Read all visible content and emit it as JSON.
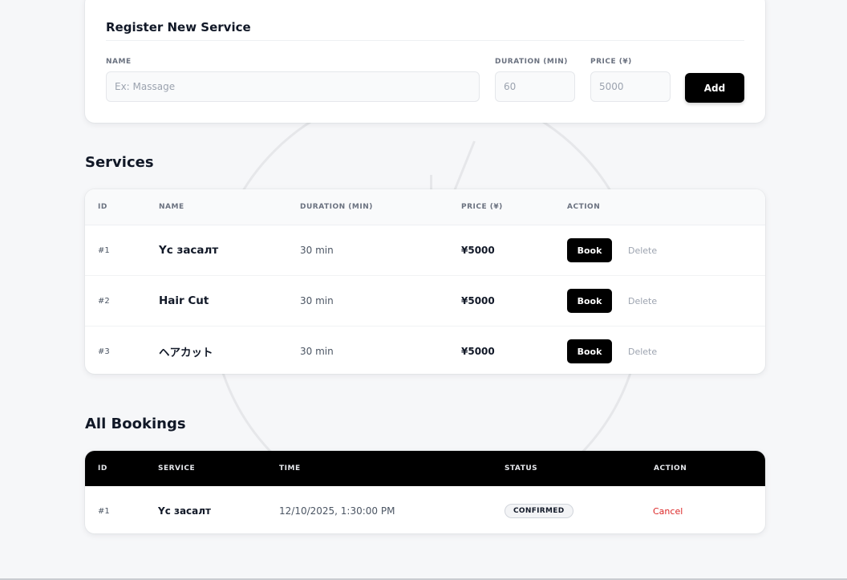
{
  "register": {
    "title": "Register New Service",
    "name_label": "NAME",
    "name_placeholder": "Ex: Massage",
    "duration_label": "DURATION (MIN)",
    "duration_placeholder": "60",
    "price_label": "PRICE (¥)",
    "price_placeholder": "5000",
    "add_label": "Add"
  },
  "services": {
    "title": "Services",
    "headers": {
      "id": "ID",
      "name": "NAME",
      "duration": "DURATION (MIN)",
      "price": "PRICE (¥)",
      "action": "ACTION"
    },
    "book_label": "Book",
    "delete_label": "Delete",
    "rows": [
      {
        "id": "#1",
        "name": "Үс засалт",
        "duration": "30 min",
        "price": "¥5000"
      },
      {
        "id": "#2",
        "name": "Hair Cut",
        "duration": "30 min",
        "price": "¥5000"
      },
      {
        "id": "#3",
        "name": "ヘアカット",
        "duration": "30 min",
        "price": "¥5000"
      }
    ]
  },
  "bookings": {
    "title": "All Bookings",
    "headers": {
      "id": "ID",
      "service": "SERVICE",
      "time": "TIME",
      "status": "STATUS",
      "action": "ACTION"
    },
    "cancel_label": "Cancel",
    "rows": [
      {
        "id": "#1",
        "service": "Үс засалт",
        "time": "12/10/2025, 1:30:00 PM",
        "status": "CONFIRMED"
      }
    ]
  },
  "colors": {
    "accent": "#000000",
    "danger": "#dc2626",
    "background": "#f6f7f9"
  }
}
